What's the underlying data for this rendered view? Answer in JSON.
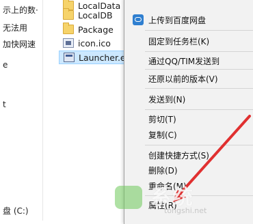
{
  "sidebar": {
    "items": [
      {
        "label": "示上的数·"
      },
      {
        "label": "无法用"
      },
      {
        "label": "加快网速"
      },
      {
        "label": "e"
      },
      {
        "label": "t"
      },
      {
        "label": "盘 (C:)"
      }
    ]
  },
  "files": [
    {
      "name": "LocalData",
      "type": "folder"
    },
    {
      "name": "LocalDB",
      "type": "folder"
    },
    {
      "name": "Package",
      "type": "folder"
    },
    {
      "name": "icon.ico",
      "type": "ico"
    },
    {
      "name": "Launcher.exe",
      "type": "exe",
      "selected": true
    }
  ],
  "context_menu": {
    "items": [
      {
        "label": "上传到百度网盘",
        "icon": "baidu-cloud-icon"
      },
      {
        "label": "固定到任务栏(K)"
      },
      {
        "label": "通过QQ/TIM发送到"
      },
      {
        "label": "还原以前的版本(V)"
      },
      {
        "label": "发送到(N)"
      },
      {
        "label": "剪切(T)"
      },
      {
        "label": "复制(C)"
      },
      {
        "label": "创建快捷方式(S)"
      },
      {
        "label": "删除(D)"
      },
      {
        "label": "重命名(M)"
      },
      {
        "label": "属性(R)"
      }
    ]
  },
  "watermark": {
    "text": "系统",
    "sub": "tongshi.net"
  },
  "colors": {
    "selection": "#cce8ff",
    "menu_bg": "#f2f2f2",
    "annotation_arrow": "#e03030"
  }
}
